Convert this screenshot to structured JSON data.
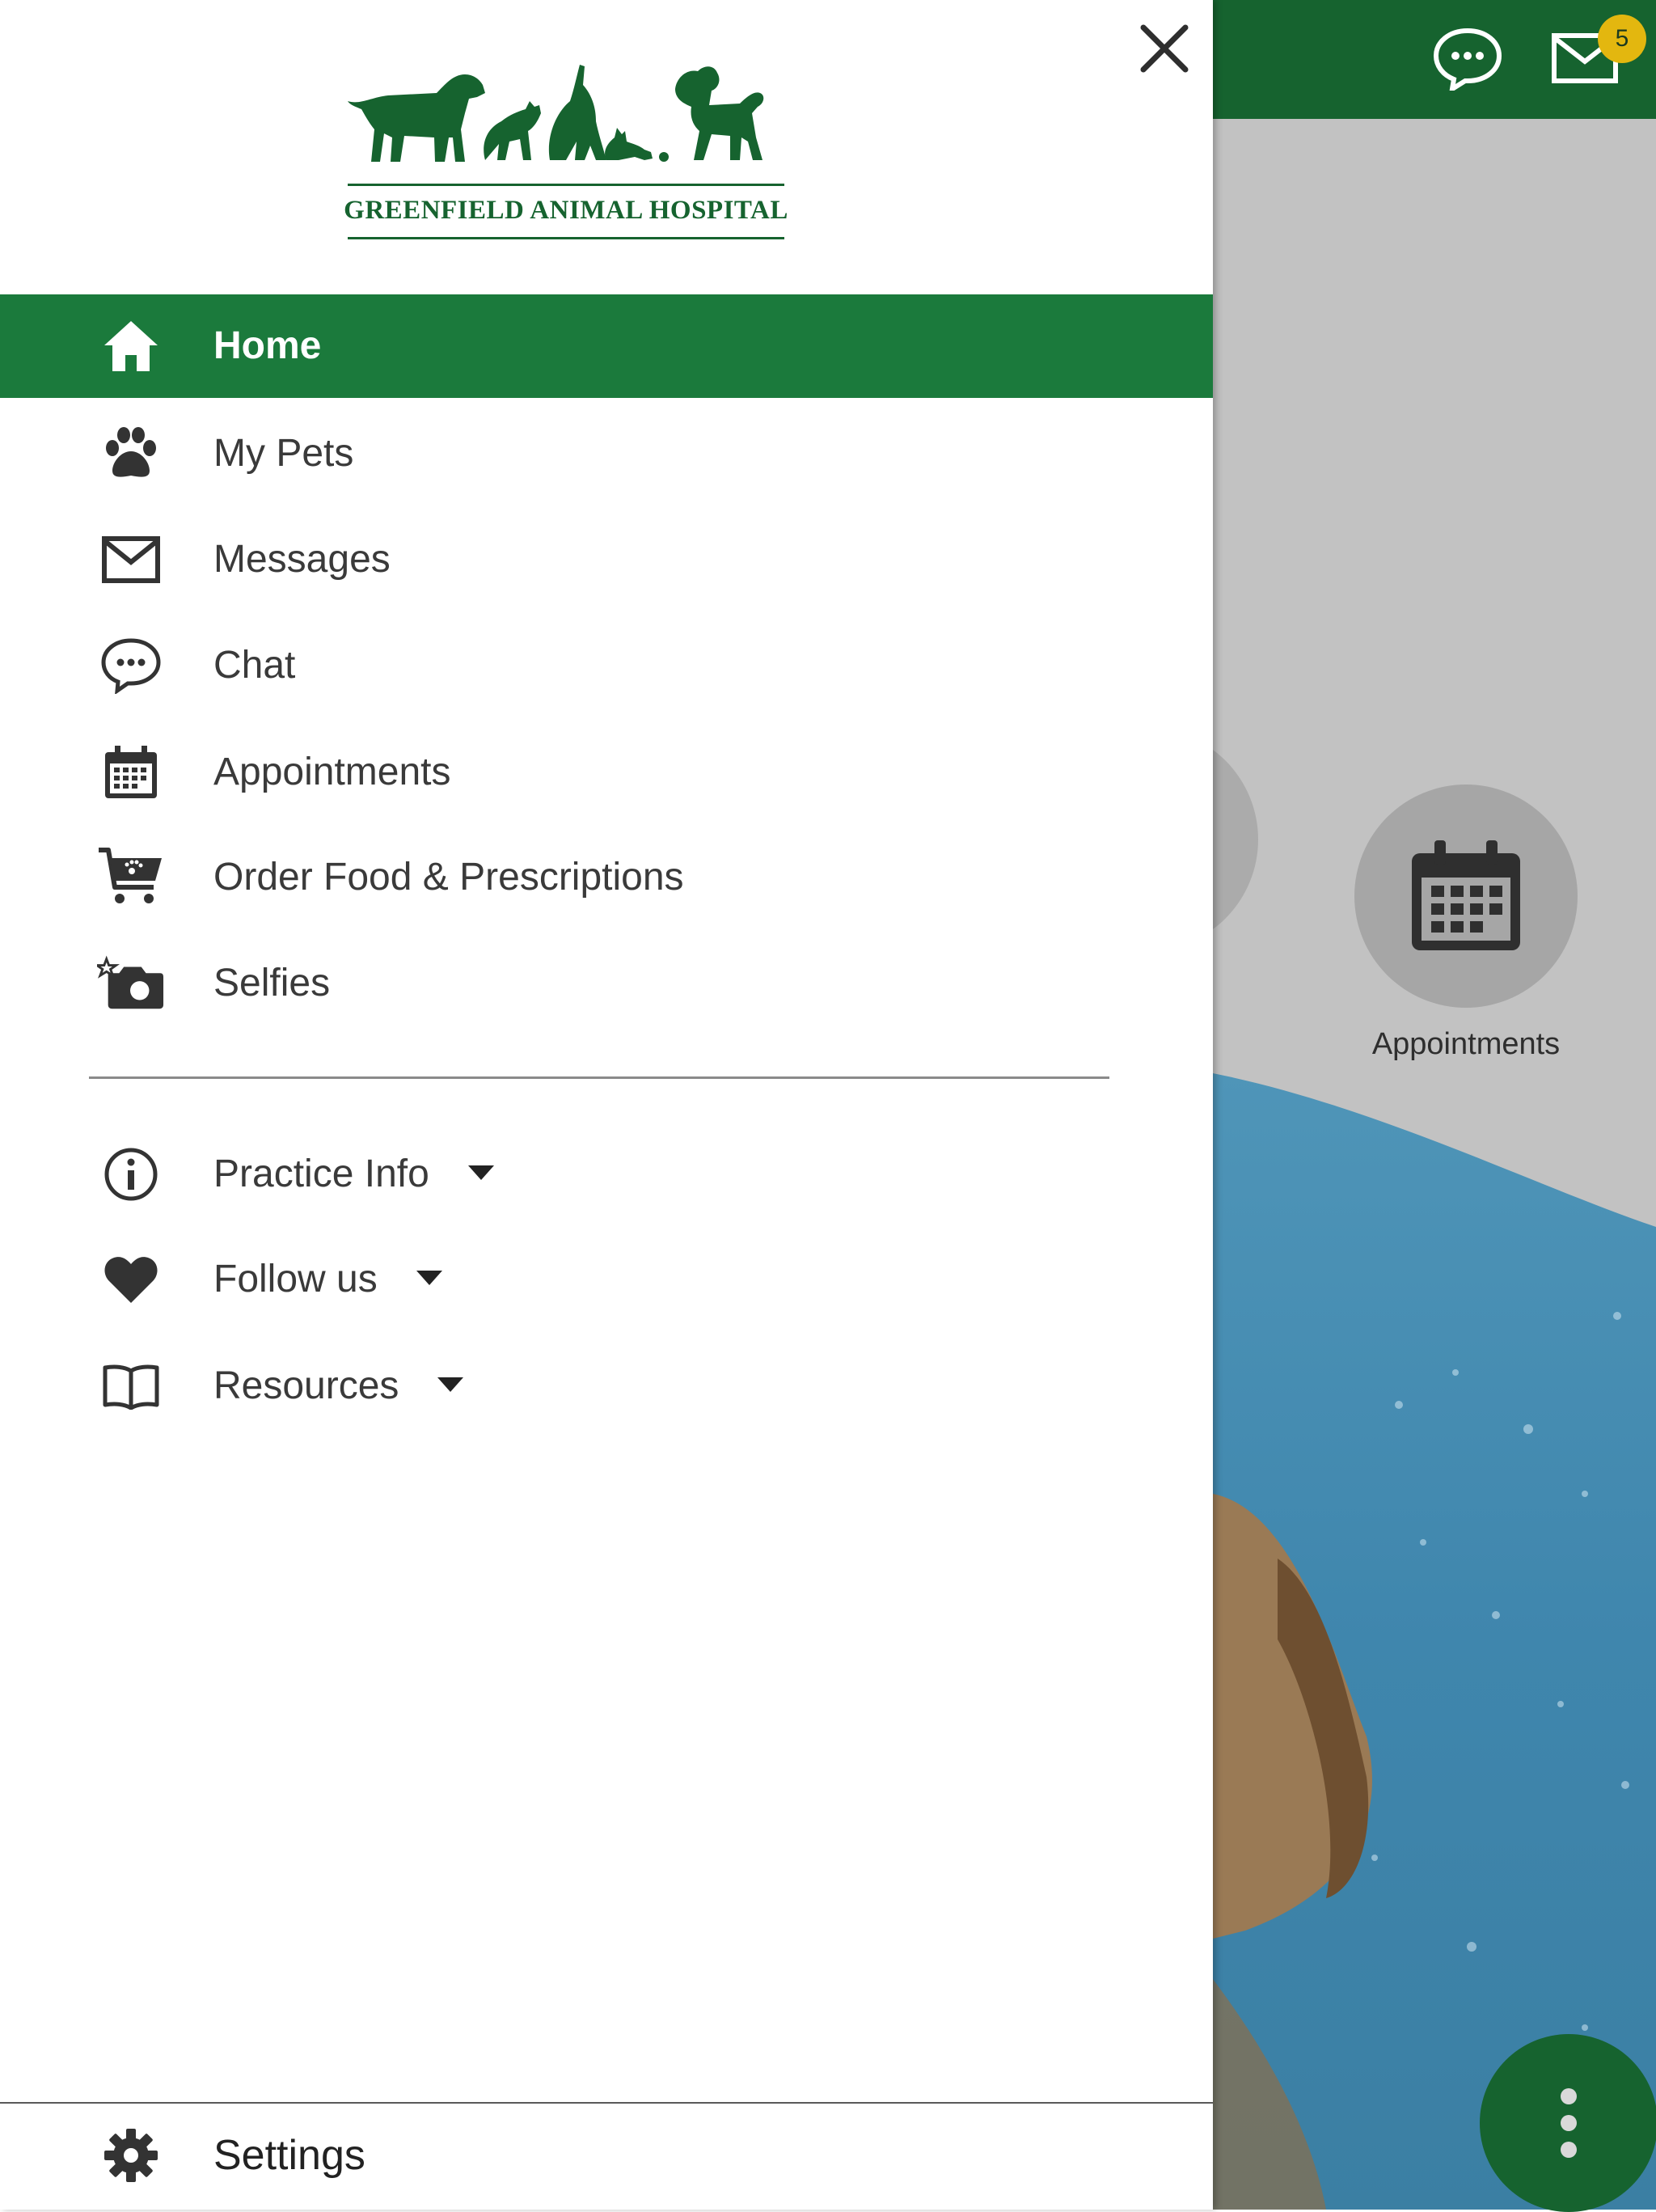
{
  "header": {
    "badge_count": "5",
    "chat_icon": "chat-icon",
    "mail_icon": "mail-icon"
  },
  "background": {
    "appointments_label": "Appointments"
  },
  "drawer": {
    "logo_text": "GREENFIELD ANIMAL HOSPITAL",
    "items": [
      {
        "label": "Home",
        "icon": "home-icon",
        "active": true
      },
      {
        "label": "My Pets",
        "icon": "paw-icon"
      },
      {
        "label": "Messages",
        "icon": "mail-icon"
      },
      {
        "label": "Chat",
        "icon": "chat-icon"
      },
      {
        "label": "Appointments",
        "icon": "calendar-icon"
      },
      {
        "label": "Order Food & Prescriptions",
        "icon": "cart-icon"
      },
      {
        "label": "Selfies",
        "icon": "camera-icon"
      }
    ],
    "expandables": [
      {
        "label": "Practice Info",
        "icon": "info-icon"
      },
      {
        "label": "Follow us",
        "icon": "heart-icon"
      },
      {
        "label": "Resources",
        "icon": "book-icon"
      }
    ],
    "settings_label": "Settings"
  },
  "colors": {
    "brand_green": "#16632f",
    "active_green": "#1b7a3c",
    "badge_yellow": "#e3b70f"
  }
}
